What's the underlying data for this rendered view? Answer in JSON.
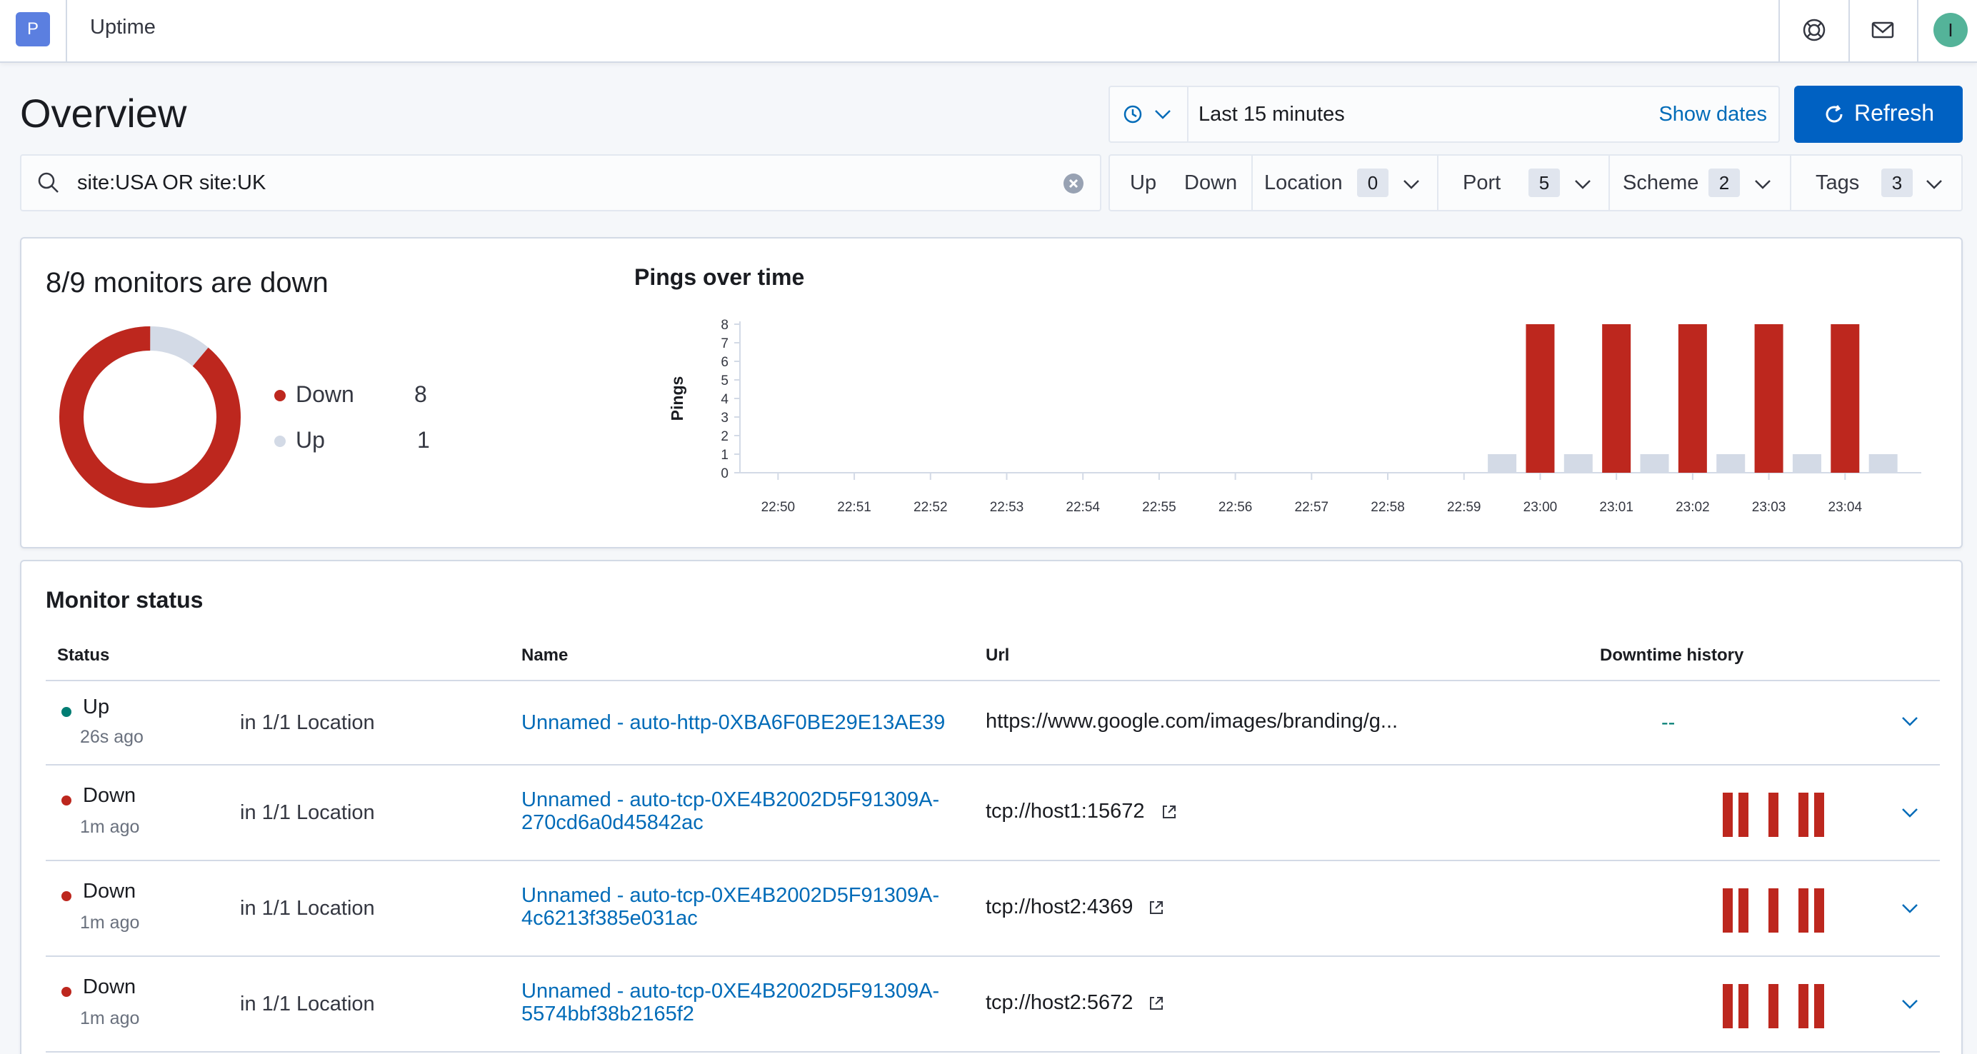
{
  "header": {
    "space_initial": "P",
    "app_title": "Uptime",
    "user_initial": "I",
    "icons": [
      "help-icon",
      "mail-icon"
    ]
  },
  "overview": {
    "title": "Overview",
    "date_range": "Last 15 minutes",
    "show_dates": "Show dates",
    "refresh": "Refresh"
  },
  "search": {
    "value": "site:USA OR site:UK"
  },
  "filters": {
    "up": "Up",
    "down": "Down",
    "location": {
      "label": "Location",
      "count": "0"
    },
    "port": {
      "label": "Port",
      "count": "5"
    },
    "scheme": {
      "label": "Scheme",
      "count": "2"
    },
    "tags": {
      "label": "Tags",
      "count": "3"
    }
  },
  "snapshot": {
    "title": "8/9 monitors are down",
    "down_label": "Down",
    "down_count": "8",
    "up_label": "Up",
    "up_count": "1",
    "colors": {
      "down": "#bd271e",
      "up": "#d3dae6"
    }
  },
  "pings_chart": {
    "title": "Pings over time"
  },
  "chart_data": {
    "type": "bar",
    "title": "Pings over time",
    "ylabel": "Pings",
    "xlabel": "",
    "ylim": [
      0,
      8
    ],
    "yticks": [
      "0",
      "1",
      "2",
      "3",
      "4",
      "5",
      "6",
      "7",
      "8"
    ],
    "xticks": [
      "22:50",
      "22:51",
      "22:52",
      "22:53",
      "22:54",
      "22:55",
      "22:56",
      "22:57",
      "22:58",
      "22:59",
      "23:00",
      "23:01",
      "23:02",
      "23:03",
      "23:04"
    ],
    "series": [
      {
        "color": "#bd271e",
        "x": [
          "23:00",
          "23:01",
          "23:02",
          "23:03",
          "23:04"
        ],
        "values": [
          8,
          8,
          8,
          8,
          8
        ]
      },
      {
        "color": "#d3dae6",
        "x": [
          "22:59:30",
          "23:00:30",
          "23:01:30",
          "23:02:30",
          "23:03:30",
          "23:04:30"
        ],
        "values": [
          1,
          1,
          1,
          1,
          1,
          1
        ]
      }
    ]
  },
  "monitor_status": {
    "title": "Monitor status",
    "columns": {
      "status": "Status",
      "name": "Name",
      "url": "Url",
      "history": "Downtime history"
    },
    "rows": [
      {
        "status": "Up",
        "ago": "26s ago",
        "location": "in 1/1 Location",
        "name": "Unnamed - auto-http-0XBA6F0BE29E13AE39",
        "url": "https://www.google.com/images/branding/g...",
        "history": "--"
      },
      {
        "status": "Down",
        "ago": "1m ago",
        "location": "in 1/1 Location",
        "name": "Unnamed - auto-tcp-0XE4B2002D5F91309A-270cd6a0d45842ac",
        "url": "tcp://host1:15672",
        "history": ""
      },
      {
        "status": "Down",
        "ago": "1m ago",
        "location": "in 1/1 Location",
        "name": "Unnamed - auto-tcp-0XE4B2002D5F91309A-4c6213f385e031ac",
        "url": "tcp://host2:4369",
        "history": ""
      },
      {
        "status": "Down",
        "ago": "1m ago",
        "location": "in 1/1 Location",
        "name": "Unnamed - auto-tcp-0XE4B2002D5F91309A-5574bbf38b2165f2",
        "url": "tcp://host2:5672",
        "history": ""
      }
    ]
  }
}
